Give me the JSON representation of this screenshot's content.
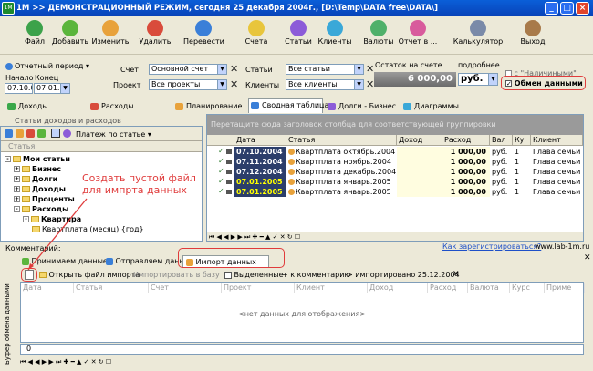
{
  "window": {
    "title": "1М >> ДЕМОНСТРАЦИОННЫЙ РЕЖИМ, сегодня 25 декабря 2004г., [D:\\Temp\\DATA free\\DATA\\]",
    "logo": "1М"
  },
  "toolbar": {
    "items": [
      {
        "label": "Файл",
        "icon": "file-icon",
        "color": "#3CA24A"
      },
      {
        "label": "Добавить",
        "icon": "add-icon",
        "color": "#5BB53C"
      },
      {
        "label": "Изменить",
        "icon": "edit-icon",
        "color": "#E8A23B"
      },
      {
        "label": "Удалить",
        "icon": "delete-icon",
        "color": "#D94B3B"
      },
      {
        "label": "Перевести",
        "icon": "transfer-icon",
        "color": "#3A7FD8"
      },
      {
        "label": "Счета",
        "icon": "accounts-icon",
        "color": "#E8C53B"
      },
      {
        "label": "Статьи",
        "icon": "articles-icon",
        "color": "#8C5BD8"
      },
      {
        "label": "Клиенты",
        "icon": "clients-icon",
        "color": "#3AA8D8"
      },
      {
        "label": "Валюты",
        "icon": "currency-icon",
        "color": "#4FB06A"
      },
      {
        "label": "Отчет в ...",
        "icon": "report-icon",
        "color": "#D85B9C"
      },
      {
        "label": "Калькулятор",
        "icon": "calculator-icon",
        "color": "#7A8AA8"
      },
      {
        "label": "Выход",
        "icon": "exit-icon",
        "color": "#A87A4A"
      }
    ]
  },
  "filters": {
    "period_label": "Отчетный период",
    "start_label": "Начало",
    "start_value": "07.10.04",
    "end_label": "Конец",
    "end_value": "07.01.05",
    "account_label": "Счет",
    "account_value": "Основной счет",
    "project_label": "Проект",
    "project_value": "Все проекты",
    "articles_label": "Статьи",
    "articles_value": "Все статьи",
    "clients_label": "Клиенты",
    "clients_value": "Все клиенты",
    "balance_label": "Остаток на счете",
    "balance_value": "6 000,00",
    "currency_value": "руб.",
    "detail_label": "подробнее",
    "cash_check_label": "с \"Наличиными\"",
    "exchange_check_label": "Обмен данными"
  },
  "tabs": [
    {
      "label": "Доходы",
      "color": "#3AA84A"
    },
    {
      "label": "Расходы",
      "color": "#D84B3B"
    },
    {
      "label": "Планирование",
      "color": "#E8A23B"
    },
    {
      "label": "Сводная таблица",
      "color": "#3A7FD8"
    },
    {
      "label": "Долги - Бизнес",
      "color": "#8C5BD8"
    },
    {
      "label": "Диаграммы",
      "color": "#3AA8D8"
    }
  ],
  "left_panel": {
    "title": "Статьи доходов и расходов",
    "filter_label": "Платеж по статье",
    "column": "Статья",
    "tree": [
      {
        "label": "Мои статьи",
        "level": 0,
        "sign": "-",
        "bold": true
      },
      {
        "label": "Бизнес",
        "level": 1,
        "sign": "+",
        "bold": true
      },
      {
        "label": "Долги",
        "level": 1,
        "sign": "+",
        "bold": true
      },
      {
        "label": "Доходы",
        "level": 1,
        "sign": "+",
        "bold": true
      },
      {
        "label": "Проценты",
        "level": 1,
        "sign": "+",
        "bold": true
      },
      {
        "label": "Расходы",
        "level": 1,
        "sign": "-",
        "bold": true
      },
      {
        "label": "Квартира",
        "level": 2,
        "sign": "-",
        "bold": true
      },
      {
        "label": "Квартплата (месяц) {год}",
        "level": 3,
        "sign": "",
        "bold": false
      }
    ]
  },
  "grid": {
    "group_hint": "Перетащите сюда заголовок столбца для соответствующей группировки",
    "columns": [
      "Дата",
      "Статья",
      "Доход",
      "Расход",
      "Вал",
      "Ку",
      "Клиент"
    ],
    "rows": [
      {
        "date": "07.10.2004",
        "article": "Квартплата октябрь.2004",
        "income": "",
        "expense": "1 000,00",
        "currency": "руб.",
        "rate": "1",
        "client": "Глава семьи"
      },
      {
        "date": "07.11.2004",
        "article": "Квартплата ноябрь.2004",
        "income": "",
        "expense": "1 000,00",
        "currency": "руб.",
        "rate": "1",
        "client": "Глава семьи"
      },
      {
        "date": "07.12.2004",
        "article": "Квартплата декабрь.2004",
        "income": "",
        "expense": "1 000,00",
        "currency": "руб.",
        "rate": "1",
        "client": "Глава семьи"
      },
      {
        "date": "07.01.2005",
        "article": "Квартплата январь.2005",
        "income": "",
        "expense": "1 000,00",
        "currency": "руб.",
        "rate": "1",
        "client": "Глава семьи"
      },
      {
        "date": "07.01.2005",
        "article": "Квартплата январь.2005",
        "income": "",
        "expense": "1 000,00",
        "currency": "руб.",
        "rate": "1",
        "client": "Глава семьи"
      }
    ]
  },
  "annotation": {
    "hint": "Создать пустой файл для импрта данных"
  },
  "footer": {
    "comments_label": "Комментарий:",
    "register_link": "Как зарегистрироваться?",
    "site": "www.lab-1m.ru"
  },
  "exchange": {
    "tabs": [
      "Принимаем данные",
      "Отправляем данные",
      "Импорт данных"
    ],
    "toolbar": {
      "open_file": "Открыть файл импорта",
      "import_db": "Импортировать в базу",
      "selected": "Выделенные",
      "add_comment": "+ к комментарию",
      "status": "> импортировано 25.12.2004"
    },
    "side_label": "Буфер обмена данными",
    "columns": [
      "Дата",
      "Статья",
      "Счет",
      "Проект",
      "Клиент",
      "Доход",
      "Расход",
      "Валюта",
      "Курс",
      "Приме"
    ],
    "empty_text": "<нет данных для отображения>",
    "count": "0"
  }
}
